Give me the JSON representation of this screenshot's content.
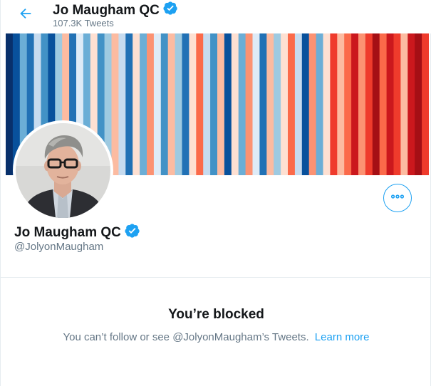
{
  "header": {
    "title": "Jo Maugham QC",
    "tweet_count": "107.3K Tweets"
  },
  "profile": {
    "name": "Jo Maugham QC",
    "handle": "@JolyonMaugham"
  },
  "blocked": {
    "title": "You’re blocked",
    "message": "You can’t follow or see @JolyonMaugham’s Tweets.",
    "link": "Learn more"
  },
  "colors": {
    "accent": "#1da1f2",
    "text": "#14171a",
    "secondary_text": "#657786",
    "divider": "#e6ecf0"
  },
  "icons": {
    "back": "back-arrow-icon",
    "verified": "verified-badge-icon",
    "more": "more-options-icon"
  },
  "banner_stripes": [
    "#08306b",
    "#08519c",
    "#6baed6",
    "#2171b5",
    "#c6dbef",
    "#4292c6",
    "#08519c",
    "#9ecae1",
    "#fcbba1",
    "#2171b5",
    "#deebf7",
    "#6baed6",
    "#fee0d2",
    "#4292c6",
    "#9ecae1",
    "#fcbba1",
    "#c6dbef",
    "#2171b5",
    "#fee0d2",
    "#6baed6",
    "#fc9272",
    "#deebf7",
    "#4292c6",
    "#fcbba1",
    "#9ecae1",
    "#2171b5",
    "#fee0d2",
    "#fb6a4a",
    "#c6dbef",
    "#4292c6",
    "#fcbba1",
    "#08519c",
    "#fee0d2",
    "#6baed6",
    "#fc9272",
    "#deebf7",
    "#2171b5",
    "#fcbba1",
    "#9ecae1",
    "#fee0d2",
    "#fb6a4a",
    "#c6dbef",
    "#08519c",
    "#fc9272",
    "#6baed6",
    "#fee0d2",
    "#ef3b2c",
    "#fcbba1",
    "#fb6a4a",
    "#cb181d",
    "#fc9272",
    "#ef3b2c",
    "#a50f15",
    "#fb6a4a",
    "#cb181d",
    "#ef3b2c",
    "#fcbba1",
    "#cb181d",
    "#a50f15",
    "#ef3b2c"
  ]
}
